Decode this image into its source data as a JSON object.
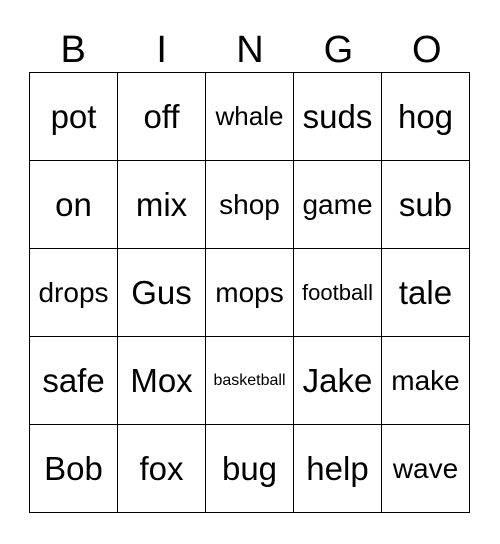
{
  "header": [
    "B",
    "I",
    "N",
    "G",
    "O"
  ],
  "rows": [
    [
      "pot",
      "off",
      "whale",
      "suds",
      "hog"
    ],
    [
      "on",
      "mix",
      "shop",
      "game",
      "sub"
    ],
    [
      "drops",
      "Gus",
      "mops",
      "football",
      "tale"
    ],
    [
      "safe",
      "Mox",
      "basketball",
      "Jake",
      "make"
    ],
    [
      "Bob",
      "fox",
      "bug",
      "help",
      "wave"
    ]
  ]
}
